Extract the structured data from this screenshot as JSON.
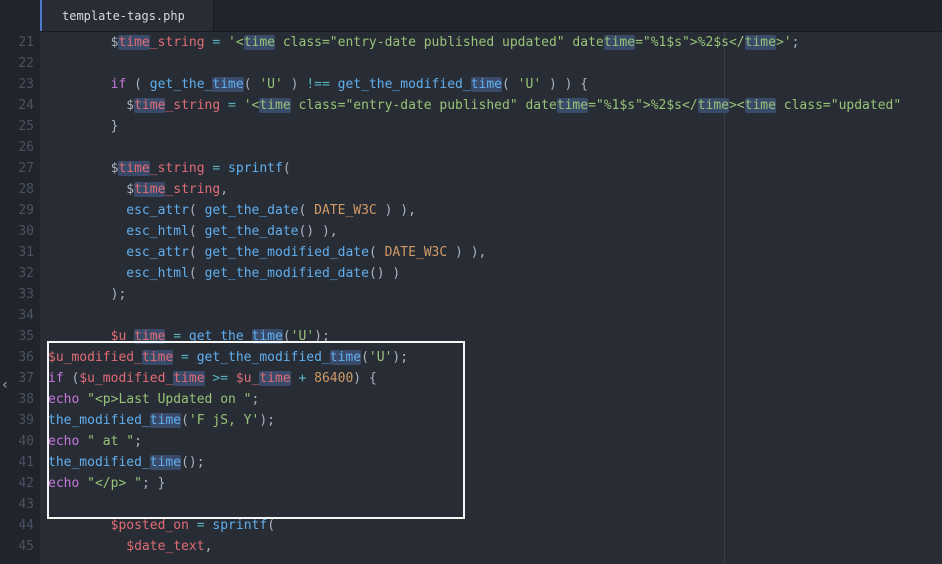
{
  "tab": {
    "title": "template-tags.php"
  },
  "highlight_word": "time",
  "box_lines": [
    35,
    42
  ],
  "lines": [
    {
      "num": 21,
      "indent": 4,
      "tokens": [
        {
          "t": "$",
          "c": "c-pun"
        },
        {
          "t": "time",
          "c": "c-var hl"
        },
        {
          "t": "_string",
          "c": "c-var"
        },
        {
          "t": " = ",
          "c": "c-op"
        },
        {
          "t": "'<",
          "c": "c-str"
        },
        {
          "t": "time",
          "c": "c-str hl"
        },
        {
          "t": " class=\"entry-date published updated\" date",
          "c": "c-str"
        },
        {
          "t": "time",
          "c": "c-str hl"
        },
        {
          "t": "=\"%1$s\">%2$s</",
          "c": "c-str"
        },
        {
          "t": "time",
          "c": "c-str hl"
        },
        {
          "t": ">'",
          "c": "c-str"
        },
        {
          "t": ";",
          "c": "c-pun"
        }
      ]
    },
    {
      "num": 22,
      "indent": 0,
      "tokens": []
    },
    {
      "num": 23,
      "indent": 4,
      "tokens": [
        {
          "t": "if",
          "c": "c-kw"
        },
        {
          "t": " ( ",
          "c": "c-pun"
        },
        {
          "t": "get_the_",
          "c": "c-fn"
        },
        {
          "t": "time",
          "c": "c-fn hl"
        },
        {
          "t": "( ",
          "c": "c-pun"
        },
        {
          "t": "'U'",
          "c": "c-str"
        },
        {
          "t": " ) ",
          "c": "c-pun"
        },
        {
          "t": "!==",
          "c": "c-op"
        },
        {
          "t": " ",
          "c": "c-pun"
        },
        {
          "t": "get_the_modified_",
          "c": "c-fn"
        },
        {
          "t": "time",
          "c": "c-fn hl"
        },
        {
          "t": "( ",
          "c": "c-pun"
        },
        {
          "t": "'U'",
          "c": "c-str"
        },
        {
          "t": " ) ) ",
          "c": "c-pun"
        },
        {
          "t": "{",
          "c": "c-pun"
        }
      ]
    },
    {
      "num": 24,
      "indent": 5,
      "tokens": [
        {
          "t": "$",
          "c": "c-pun"
        },
        {
          "t": "time",
          "c": "c-var hl"
        },
        {
          "t": "_string",
          "c": "c-var"
        },
        {
          "t": " = ",
          "c": "c-op"
        },
        {
          "t": "'<",
          "c": "c-str"
        },
        {
          "t": "time",
          "c": "c-str hl"
        },
        {
          "t": " class=\"entry-date published\" date",
          "c": "c-str"
        },
        {
          "t": "time",
          "c": "c-str hl"
        },
        {
          "t": "=\"%1$s\">%2$s</",
          "c": "c-str"
        },
        {
          "t": "time",
          "c": "c-str hl"
        },
        {
          "t": "><",
          "c": "c-str"
        },
        {
          "t": "time",
          "c": "c-str hl"
        },
        {
          "t": " class=\"updated\"",
          "c": "c-str"
        }
      ]
    },
    {
      "num": 25,
      "indent": 4,
      "tokens": [
        {
          "t": "}",
          "c": "c-pun"
        }
      ]
    },
    {
      "num": 26,
      "indent": 0,
      "tokens": []
    },
    {
      "num": 27,
      "indent": 4,
      "tokens": [
        {
          "t": "$",
          "c": "c-pun"
        },
        {
          "t": "time",
          "c": "c-var hl"
        },
        {
          "t": "_string",
          "c": "c-var"
        },
        {
          "t": " = ",
          "c": "c-op"
        },
        {
          "t": "sprintf",
          "c": "c-fn"
        },
        {
          "t": "(",
          "c": "c-pun"
        }
      ]
    },
    {
      "num": 28,
      "indent": 5,
      "tokens": [
        {
          "t": "$",
          "c": "c-pun"
        },
        {
          "t": "time",
          "c": "c-var hl"
        },
        {
          "t": "_string",
          "c": "c-var"
        },
        {
          "t": ",",
          "c": "c-pun"
        }
      ]
    },
    {
      "num": 29,
      "indent": 5,
      "tokens": [
        {
          "t": "esc_attr",
          "c": "c-fn"
        },
        {
          "t": "( ",
          "c": "c-pun"
        },
        {
          "t": "get_the_date",
          "c": "c-fn"
        },
        {
          "t": "( ",
          "c": "c-pun"
        },
        {
          "t": "DATE_W3C",
          "c": "c-const"
        },
        {
          "t": " ) ),",
          "c": "c-pun"
        }
      ]
    },
    {
      "num": 30,
      "indent": 5,
      "tokens": [
        {
          "t": "esc_html",
          "c": "c-fn"
        },
        {
          "t": "( ",
          "c": "c-pun"
        },
        {
          "t": "get_the_date",
          "c": "c-fn"
        },
        {
          "t": "() ),",
          "c": "c-pun"
        }
      ]
    },
    {
      "num": 31,
      "indent": 5,
      "tokens": [
        {
          "t": "esc_attr",
          "c": "c-fn"
        },
        {
          "t": "( ",
          "c": "c-pun"
        },
        {
          "t": "get_the_modified_date",
          "c": "c-fn"
        },
        {
          "t": "( ",
          "c": "c-pun"
        },
        {
          "t": "DATE_W3C",
          "c": "c-const"
        },
        {
          "t": " ) ),",
          "c": "c-pun"
        }
      ]
    },
    {
      "num": 32,
      "indent": 5,
      "tokens": [
        {
          "t": "esc_html",
          "c": "c-fn"
        },
        {
          "t": "( ",
          "c": "c-pun"
        },
        {
          "t": "get_the_modified_date",
          "c": "c-fn"
        },
        {
          "t": "() )",
          "c": "c-pun"
        }
      ]
    },
    {
      "num": 33,
      "indent": 4,
      "tokens": [
        {
          "t": ");",
          "c": "c-pun"
        }
      ]
    },
    {
      "num": 34,
      "indent": 0,
      "tokens": []
    },
    {
      "num": 35,
      "indent": 4,
      "tokens": [
        {
          "t": "$u_",
          "c": "c-var"
        },
        {
          "t": "time",
          "c": "c-var hl"
        },
        {
          "t": " = ",
          "c": "c-op"
        },
        {
          "t": "get_the_",
          "c": "c-fn"
        },
        {
          "t": "time",
          "c": "c-fn hl"
        },
        {
          "t": "(",
          "c": "c-pun"
        },
        {
          "t": "'U'",
          "c": "c-str"
        },
        {
          "t": ");",
          "c": "c-pun"
        }
      ]
    },
    {
      "num": 36,
      "indent": 0,
      "tokens": [
        {
          "t": "$u_modified_",
          "c": "c-var"
        },
        {
          "t": "time",
          "c": "c-var hl"
        },
        {
          "t": " = ",
          "c": "c-op"
        },
        {
          "t": "get_the_modified_",
          "c": "c-fn"
        },
        {
          "t": "time",
          "c": "c-fn hl"
        },
        {
          "t": "(",
          "c": "c-pun"
        },
        {
          "t": "'U'",
          "c": "c-str"
        },
        {
          "t": ");",
          "c": "c-pun"
        }
      ]
    },
    {
      "num": 37,
      "indent": 0,
      "tokens": [
        {
          "t": "if",
          "c": "c-kw"
        },
        {
          "t": " (",
          "c": "c-pun"
        },
        {
          "t": "$u_modified_",
          "c": "c-var"
        },
        {
          "t": "time",
          "c": "c-var hl"
        },
        {
          "t": " >= ",
          "c": "c-op"
        },
        {
          "t": "$u_",
          "c": "c-var"
        },
        {
          "t": "time",
          "c": "c-var hl"
        },
        {
          "t": " + ",
          "c": "c-op"
        },
        {
          "t": "86400",
          "c": "c-const"
        },
        {
          "t": ") ",
          "c": "c-pun"
        },
        {
          "t": "{",
          "c": "c-pun"
        }
      ]
    },
    {
      "num": 38,
      "indent": 0,
      "tokens": [
        {
          "t": "echo",
          "c": "c-kw"
        },
        {
          "t": " ",
          "c": "c-pun"
        },
        {
          "t": "\"<p>Last Updated on \"",
          "c": "c-str"
        },
        {
          "t": ";",
          "c": "c-pun"
        }
      ]
    },
    {
      "num": 39,
      "indent": 0,
      "tokens": [
        {
          "t": "the_modified_",
          "c": "c-fn"
        },
        {
          "t": "time",
          "c": "c-fn hl"
        },
        {
          "t": "(",
          "c": "c-pun"
        },
        {
          "t": "'F jS, Y'",
          "c": "c-str"
        },
        {
          "t": ");",
          "c": "c-pun"
        }
      ]
    },
    {
      "num": 40,
      "indent": 0,
      "tokens": [
        {
          "t": "echo",
          "c": "c-kw"
        },
        {
          "t": " ",
          "c": "c-pun"
        },
        {
          "t": "\" at \"",
          "c": "c-str"
        },
        {
          "t": ";",
          "c": "c-pun"
        }
      ]
    },
    {
      "num": 41,
      "indent": 0,
      "tokens": [
        {
          "t": "the_modified_",
          "c": "c-fn"
        },
        {
          "t": "time",
          "c": "c-fn hl"
        },
        {
          "t": "();",
          "c": "c-pun"
        }
      ]
    },
    {
      "num": 42,
      "indent": 0,
      "tokens": [
        {
          "t": "echo",
          "c": "c-kw"
        },
        {
          "t": " ",
          "c": "c-pun"
        },
        {
          "t": "\"</p> \"",
          "c": "c-str"
        },
        {
          "t": "; ",
          "c": "c-pun"
        },
        {
          "t": "}",
          "c": "c-pun"
        }
      ]
    },
    {
      "num": 43,
      "indent": 0,
      "tokens": []
    },
    {
      "num": 44,
      "indent": 4,
      "tokens": [
        {
          "t": "$posted_on",
          "c": "c-var"
        },
        {
          "t": " = ",
          "c": "c-op"
        },
        {
          "t": "sprintf",
          "c": "c-fn"
        },
        {
          "t": "(",
          "c": "c-pun"
        }
      ]
    },
    {
      "num": 45,
      "indent": 5,
      "tokens": [
        {
          "t": "$date_text",
          "c": "c-var"
        },
        {
          "t": ",",
          "c": "c-pun"
        }
      ]
    }
  ]
}
